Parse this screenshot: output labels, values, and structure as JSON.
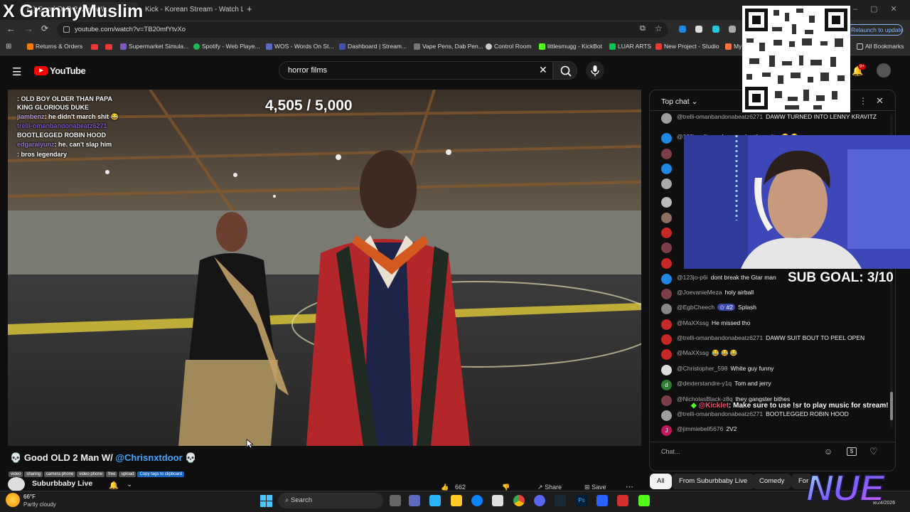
{
  "browser": {
    "tabs": [
      {
        "label": "(1) Good OLD 2 Man W/..."
      },
      {
        "label": "Kick - Korean Stream - Watch Live on..."
      }
    ],
    "new_tab": "+",
    "url": "youtube.com/watch?v=TB20mfYtvXo",
    "relaunch": "Relaunch to update",
    "bookmarks": [
      {
        "label": "Returns & Orders",
        "color": "#f57c00"
      },
      {
        "label": "Supermarket Simula...",
        "color": "#7e57c2"
      },
      {
        "label": "Spotify - Web Playe...",
        "color": "#1db954"
      },
      {
        "label": "WOS - Words On St...",
        "color": "#5c6bc0"
      },
      {
        "label": "Dashboard | Stream...",
        "color": "#3f51b5"
      },
      {
        "label": "Vape Pens, Dab Pen...",
        "color": "#777777"
      },
      {
        "label": "Control Room",
        "color": "#cccccc"
      },
      {
        "label": "littlesmugg - KickBot",
        "color": "#53fc18"
      },
      {
        "label": "LUAR ARTS",
        "color": "#00c853"
      },
      {
        "label": "New Project - Studio",
        "color": "#e53935"
      },
      {
        "label": "My",
        "color": "#ff7043"
      }
    ],
    "all_bookmarks": "All Bookmarks"
  },
  "youtube": {
    "logo": "YouTube",
    "search_value": "horror films",
    "notif_badge": "9+"
  },
  "video": {
    "counter": "4,505 / 5,000",
    "overlay_chat": [
      {
        "user": "",
        "text": ": OLD BOY OLDER THAN PAPA"
      },
      {
        "user": "",
        "text": "KING GLORIOUS DUKE"
      },
      {
        "user": "jiambenz",
        "text": ": he didn't march shit 😂"
      },
      {
        "user": "trelli-omanbandonabeatz6271",
        "text": ""
      },
      {
        "user": "",
        "text": "BOOTLEGGED ROBIN HOOD"
      },
      {
        "user": "edgaraiyunz",
        "text": ": he. can't slap him"
      },
      {
        "user": "",
        "text": ": bros legendary"
      }
    ],
    "title_emoji_left": "💀",
    "title": "Good OLD 2 Man W/ ",
    "title_mention": "@Chrisnxtdoor",
    "title_emoji_right": "💀",
    "tags": [
      "video",
      "sharing",
      "camera phone",
      "video phone",
      "free",
      "upload"
    ],
    "copy_tags": "Copy tags to clipboard",
    "channel": "Suburbbaby Live",
    "likes": "662",
    "share": "Share",
    "save": "Save"
  },
  "chat": {
    "header": "Top chat",
    "messages": [
      {
        "author": "@trelli-omanbandonabeatz6271",
        "text": "DAWW TURNED INTO LENNY KRAVITZ",
        "color": "#9e9e9e"
      },
      {
        "author": "@123jo-p6i",
        "text": "aye he can play the guitar 😂 😂",
        "color": "#1e88e5"
      },
      {
        "author": "@123jo-p6i",
        "text": "dont break the Gtar man",
        "color": "#1e88e5"
      },
      {
        "author": "@JoevanieMeza",
        "text": "holy airball",
        "color": "#7b3f4a"
      },
      {
        "author": "@EgbCheech",
        "badge": "#2",
        "text": "Splash",
        "color": "#888888"
      },
      {
        "author": "@MaXXssg",
        "text": "He missed tho",
        "color": "#c62828"
      },
      {
        "author": "@trelli-omanbandonabeatz6271",
        "text": "DAWW SUIT BOUT TO PEEL OPEN",
        "color": "#c62828"
      },
      {
        "author": "@MaXXssg",
        "text": "😂 😂 😂",
        "color": "#c62828"
      },
      {
        "author": "@Christopher_598",
        "text": "White guy funny",
        "color": "#dddddd"
      },
      {
        "author": "@dexterstandre-y1q",
        "text": "Tom and jerry",
        "color": "#2e7d32"
      },
      {
        "author": "@NicholasBlack-z8q",
        "text": "they gangster bithes",
        "color": "#7b3f4a"
      },
      {
        "author": "@trelli-omanbandonabeatz6271",
        "text": "BOOTLEGGED ROBIN HOOD",
        "color": "#9e9e9e"
      },
      {
        "author": "@jimmiebell5676",
        "text": "2V2",
        "color": "#c2185b"
      }
    ],
    "avatar_initials": {
      "dexter": "d",
      "jimmie": "J"
    },
    "input_placeholder": "Chat..."
  },
  "stream_overlay": {
    "x_logo": "X",
    "streamer": "GrannyMuslim",
    "sub_goal": "SUB GOAL: 3/10",
    "kick_user": "@Kicklet",
    "kick_text": ": Make sure to use !sr to play music for stream!",
    "nue": "NUE"
  },
  "chips": [
    "All",
    "From Suburbbaby Live",
    "Comedy",
    "For"
  ],
  "taskbar": {
    "weather_temp": "66°F",
    "weather_desc": "Partly cloudy",
    "search": "Search",
    "date": "8/24/2026"
  }
}
